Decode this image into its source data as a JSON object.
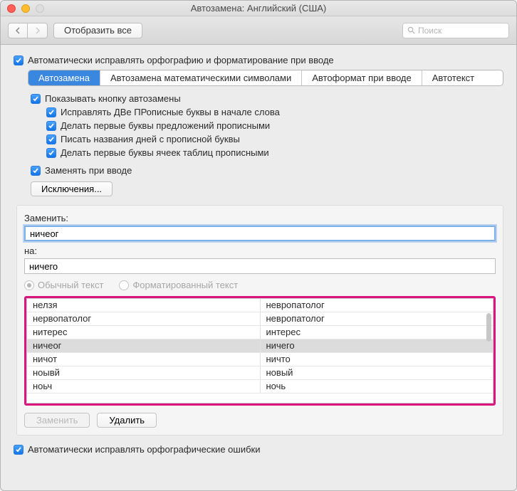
{
  "window": {
    "title": "Автозамена: Английский (США)"
  },
  "toolbar": {
    "show_all": "Отобразить все",
    "search_placeholder": "Поиск"
  },
  "main_check": "Автоматически исправлять орфографию и форматирование при вводе",
  "tabs": [
    {
      "label": "Автозамена",
      "active": true
    },
    {
      "label": "Автозамена математическими символами",
      "active": false
    },
    {
      "label": "Автоформат при вводе",
      "active": false
    },
    {
      "label": "Автотекст",
      "active": false
    }
  ],
  "options": {
    "show_btn": "Показывать кнопку автозамены",
    "fix_two_caps": "Исправлять ДВе ПРописные буквы в начале слова",
    "sentence_caps": "Делать первые буквы предложений прописными",
    "day_caps": "Писать названия дней с прописной буквы",
    "cell_caps": "Делать первые буквы ячеек таблиц прописными",
    "replace_on_type": "Заменять при вводе",
    "exceptions": "Исключения..."
  },
  "form": {
    "replace_label": "Заменить:",
    "replace_value": "ничеог",
    "with_label": "на:",
    "with_value": "ничего",
    "radio_plain": "Обычный текст",
    "radio_formatted": "Форматированный текст"
  },
  "table": {
    "rows": [
      {
        "from": "нелзя",
        "to": "невропатолог",
        "selected": false
      },
      {
        "from": "нервопатолог",
        "to": "невропатолог",
        "selected": false
      },
      {
        "from": "нитерес",
        "to": "интерес",
        "selected": false
      },
      {
        "from": "ничеог",
        "to": "ничего",
        "selected": true
      },
      {
        "from": "ничот",
        "to": "ничто",
        "selected": false
      },
      {
        "from": "ноывй",
        "to": "новый",
        "selected": false
      },
      {
        "from": "ноьч",
        "to": "ночь",
        "selected": false
      }
    ]
  },
  "actions": {
    "replace": "Заменить",
    "delete": "Удалить"
  },
  "bottom_check": "Автоматически исправлять орфографические ошибки"
}
